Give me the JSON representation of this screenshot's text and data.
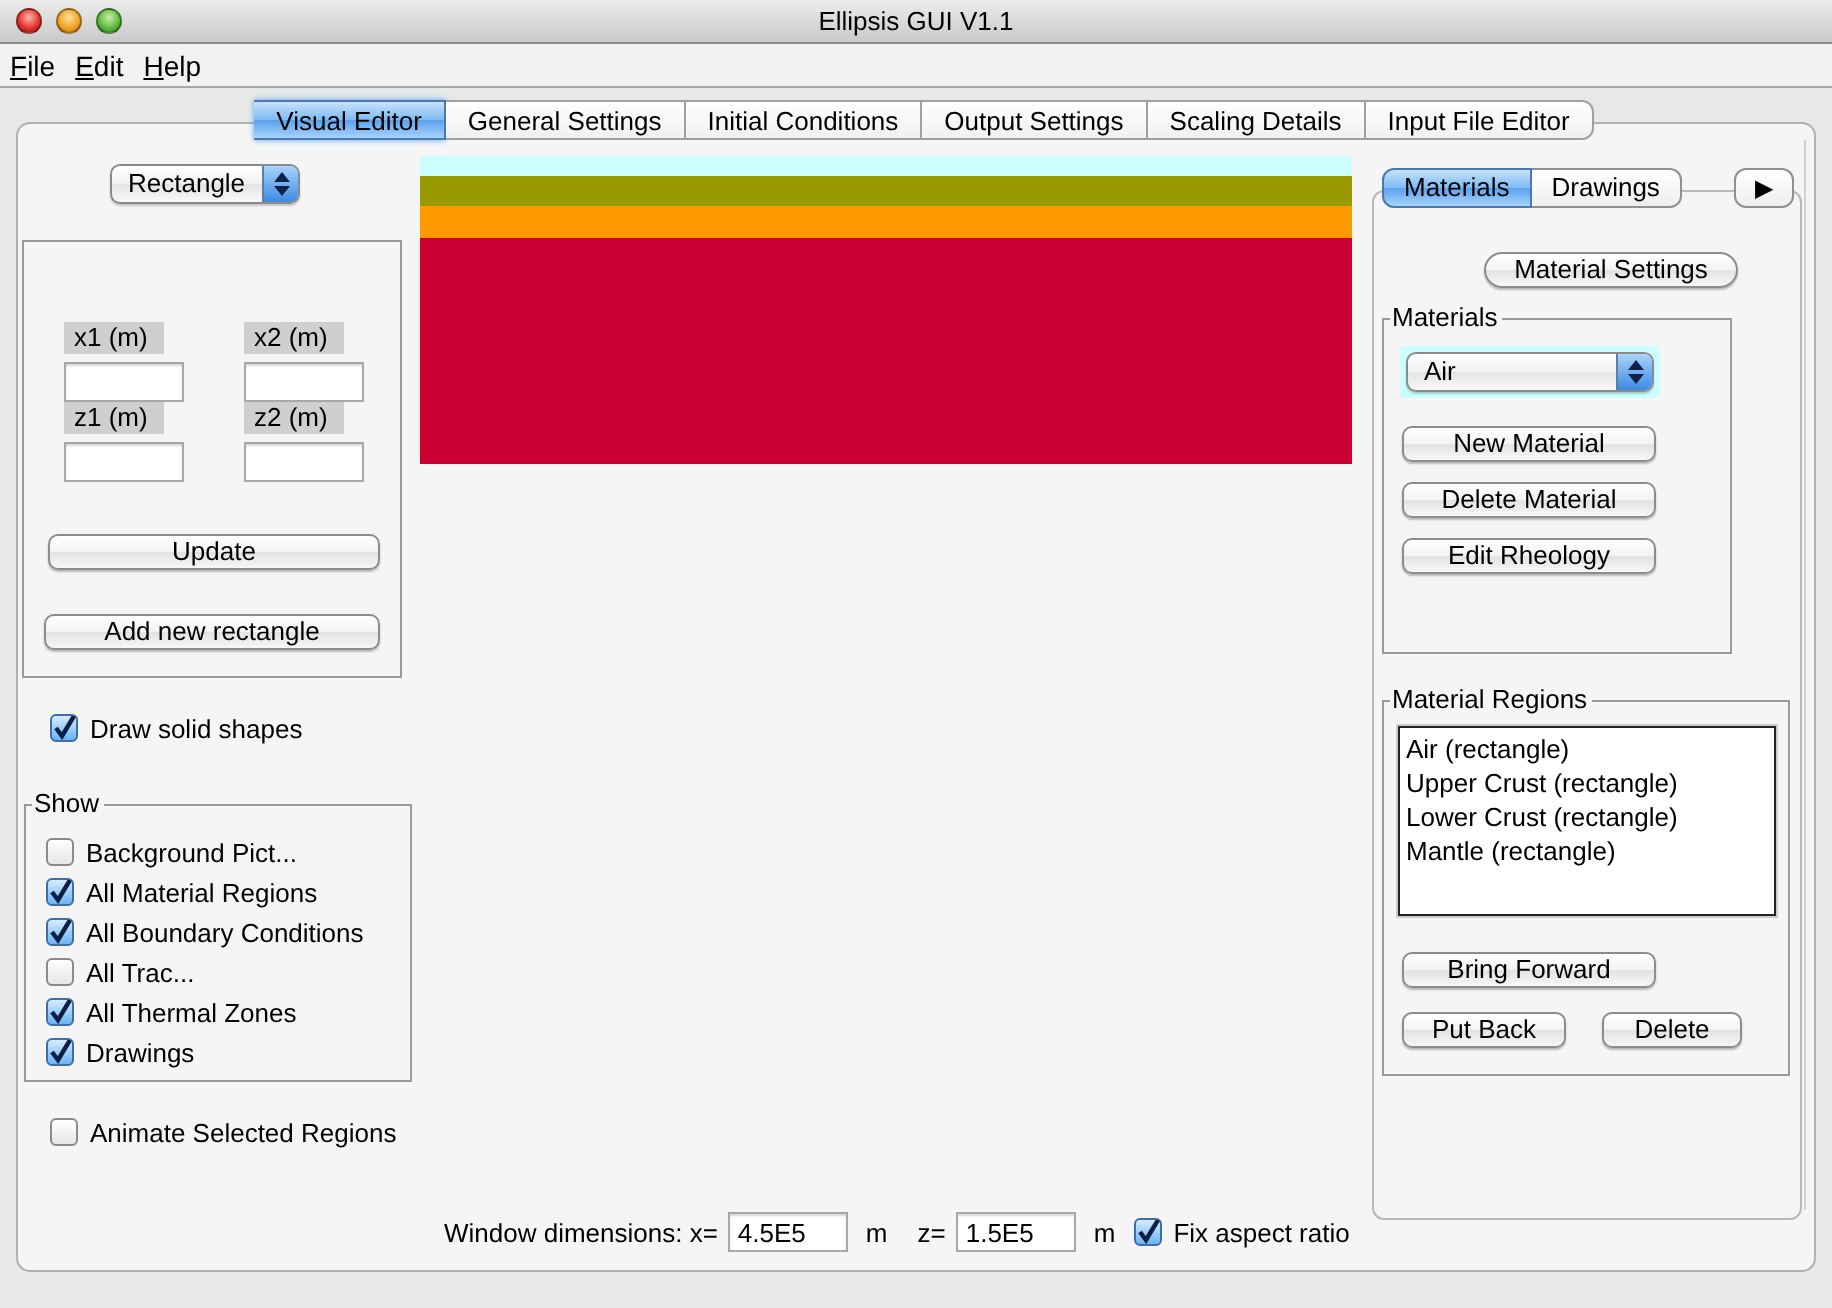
{
  "window": {
    "title": "Ellipsis GUI V1.1"
  },
  "menu": [
    "File",
    "Edit",
    "Help"
  ],
  "tabs": [
    {
      "label": "Visual Editor",
      "selected": true
    },
    {
      "label": "General Settings",
      "selected": false
    },
    {
      "label": "Initial Conditions",
      "selected": false
    },
    {
      "label": "Output Settings",
      "selected": false
    },
    {
      "label": "Scaling Details",
      "selected": false
    },
    {
      "label": "Input File Editor",
      "selected": false
    }
  ],
  "shape_select": {
    "value": "Rectangle"
  },
  "coordinates": [
    {
      "label": "x1 (m)"
    },
    {
      "label": "x2 (m)"
    },
    {
      "label": "z1 (m)"
    },
    {
      "label": "z2 (m)"
    }
  ],
  "shape_buttons": [
    "Update",
    "Add new rectangle"
  ],
  "draw_solid": {
    "label": "Draw solid shapes",
    "checked": true
  },
  "show": {
    "title": "Show",
    "items": [
      {
        "label": "Background Pict...",
        "checked": false
      },
      {
        "label": "All Material Regions",
        "checked": true
      },
      {
        "label": "All Boundary Conditions",
        "checked": true
      },
      {
        "label": "All Trac...",
        "checked": false
      },
      {
        "label": "All Thermal Zones",
        "checked": true
      },
      {
        "label": "Drawings",
        "checked": true
      }
    ]
  },
  "animate": {
    "label": "Animate Selected Regions",
    "checked": false
  },
  "canvas": {
    "layers": [
      {
        "color": "#ccffff"
      },
      {
        "color": "#999900"
      },
      {
        "color": "#ff9900"
      },
      {
        "color": "#cc0033"
      }
    ]
  },
  "side_tabs": [
    {
      "label": "Materials",
      "selected": true
    },
    {
      "label": "Drawings",
      "selected": false
    }
  ],
  "more_tab": "▶",
  "material_settings_button": "Material Settings",
  "materials": {
    "title": "Materials",
    "selected_material": "Air",
    "buttons": [
      "New Material",
      "Delete Material",
      "Edit Rheology"
    ]
  },
  "material_regions": {
    "title": "Material Regions",
    "items": [
      {
        "label": "Air (rectangle)",
        "selected": false
      },
      {
        "label": "Upper Crust (rectangle)",
        "selected": false
      },
      {
        "label": "Lower Crust (rectangle)",
        "selected": false
      },
      {
        "label": "Mantle (rectangle)",
        "selected": false
      }
    ],
    "buttons": [
      "Bring Forward",
      "Put Back",
      "Delete"
    ]
  },
  "window_dimensions": {
    "label": "Window dimensions:",
    "x_label": "x=",
    "x_value": "4.5E5",
    "x_unit": "m",
    "z_label": "z=",
    "z_value": "1.5E5",
    "z_unit": "m",
    "fix_aspect": {
      "label": "Fix aspect ratio",
      "checked": true
    }
  }
}
